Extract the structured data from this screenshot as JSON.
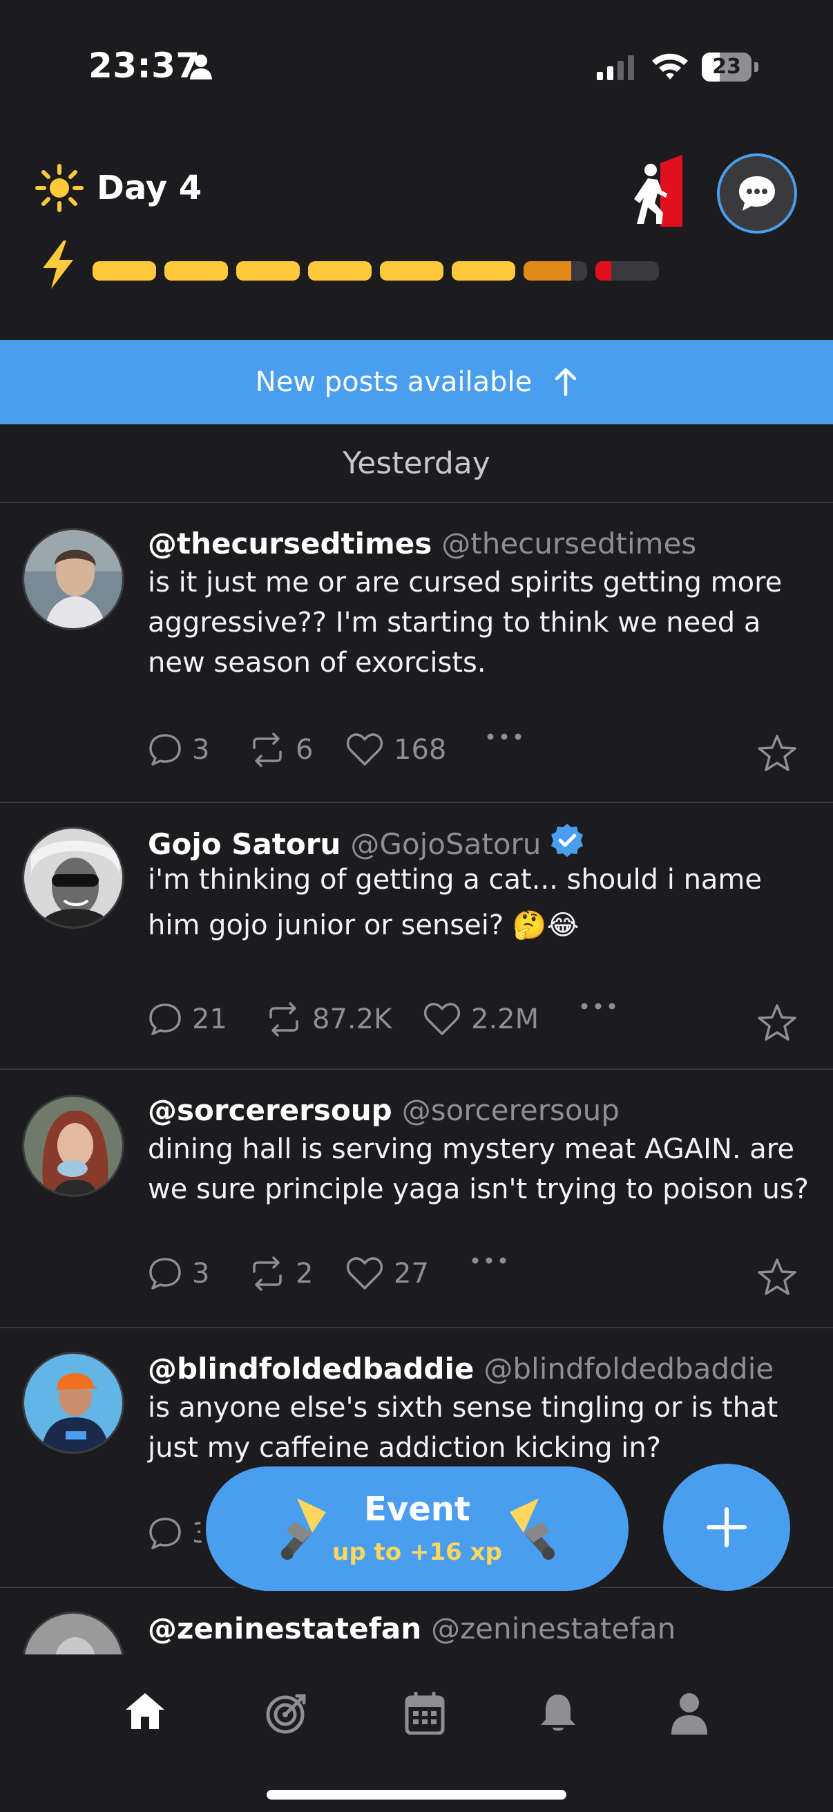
{
  "status_bar": {
    "time": "23:37",
    "battery": "23"
  },
  "header": {
    "day_label": "Day 4",
    "energy_bars": [
      {
        "color": "#ffc93c",
        "fill": 1
      },
      {
        "color": "#ffc93c",
        "fill": 1
      },
      {
        "color": "#ffc93c",
        "fill": 1
      },
      {
        "color": "#ffc93c",
        "fill": 1
      },
      {
        "color": "#ffc93c",
        "fill": 1
      },
      {
        "color": "#ffc93c",
        "fill": 1
      },
      {
        "color": "#e08a1a",
        "fill": 0.75
      },
      {
        "color": "#e0101e",
        "fill": 0.25
      }
    ]
  },
  "banner": {
    "new_posts": "New posts available"
  },
  "feed": {
    "section_label": "Yesterday",
    "posts": [
      {
        "display_name": "@thecursedtimes",
        "handle": "@thecursedtimes",
        "verified": false,
        "text": "is it just me or are cursed spirits getting more aggressive?? I'm starting to think we need a new season of exorcists.",
        "replies": "3",
        "reposts": "6",
        "likes": "168"
      },
      {
        "display_name": "Gojo Satoru",
        "handle": "@GojoSatoru",
        "verified": true,
        "text": "i'm thinking of getting a cat... should i name him gojo junior or sensei? 🤔😂",
        "replies": "21",
        "reposts": "87.2K",
        "likes": "2.2M"
      },
      {
        "display_name": "@sorcerersoup",
        "handle": "@sorcerersoup",
        "verified": false,
        "text": "dining hall is serving mystery meat AGAIN. are we sure principle yaga isn't trying to poison us?",
        "replies": "3",
        "reposts": "2",
        "likes": "27"
      },
      {
        "display_name": "@blindfoldedbaddie",
        "handle": "@blindfoldedbaddie",
        "verified": false,
        "text": "is anyone else's sixth sense tingling or is that just my caffeine addiction kicking in?",
        "replies": "3"
      },
      {
        "display_name": "@zeninestatefan",
        "handle": "@zeninestatefan",
        "verified": false
      }
    ]
  },
  "event_button": {
    "title": "Event",
    "subtitle": "up to +16 xp"
  },
  "tabbar": {
    "icons": [
      "home-icon",
      "target-icon",
      "calendar-icon",
      "bell-icon",
      "profile-icon"
    ]
  },
  "colors": {
    "accent": "#4a9eef",
    "background": "#1c1c1e",
    "xp_yellow": "#ffd75e"
  }
}
